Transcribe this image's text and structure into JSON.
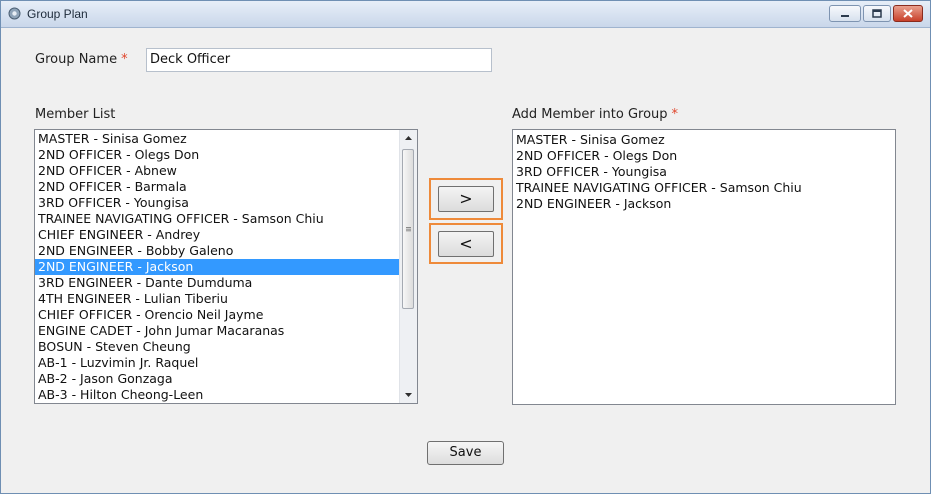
{
  "window": {
    "title": "Group Plan",
    "controls": [
      "minimize-icon",
      "maximize-icon",
      "close-icon"
    ]
  },
  "group_name": {
    "label": "Group Name",
    "required_mark": "*",
    "value": "Deck Officer"
  },
  "member_list": {
    "label": "Member List",
    "selected_index": 8,
    "items": [
      "MASTER - Sinisa Gomez",
      "2ND OFFICER - Olegs Don",
      "2ND OFFICER - Abnew",
      "2ND OFFICER - Barmala",
      "3RD OFFICER - Youngisa",
      "TRAINEE NAVIGATING OFFICER - Samson Chiu",
      "CHIEF ENGINEER - Andrey",
      "2ND ENGINEER - Bobby Galeno",
      "2ND ENGINEER - Jackson",
      "3RD ENGINEER - Dante Dumduma",
      "4TH ENGINEER - Lulian Tiberiu",
      "CHIEF OFFICER - Orencio Neil Jayme",
      "ENGINE CADET - John Jumar Macaranas",
      "BOSUN - Steven Cheung",
      "AB-1 - Luzvimin Jr. Raquel",
      "AB-2 - Jason Gonzaga",
      "AB-3 - Hilton Cheong-Leen"
    ]
  },
  "group_members": {
    "label": "Add Member into Group",
    "required_mark": "*",
    "items": [
      "MASTER - Sinisa Gomez",
      "2ND OFFICER - Olegs Don",
      "3RD OFFICER - Youngisa",
      "TRAINEE NAVIGATING OFFICER - Samson Chiu",
      "2ND ENGINEER - Jackson"
    ]
  },
  "buttons": {
    "add_label": ">",
    "remove_label": "<",
    "save_label": "Save"
  },
  "colors": {
    "selection": "#3399ff",
    "highlight_frame": "#ee8a3a",
    "required": "#e0452b"
  }
}
